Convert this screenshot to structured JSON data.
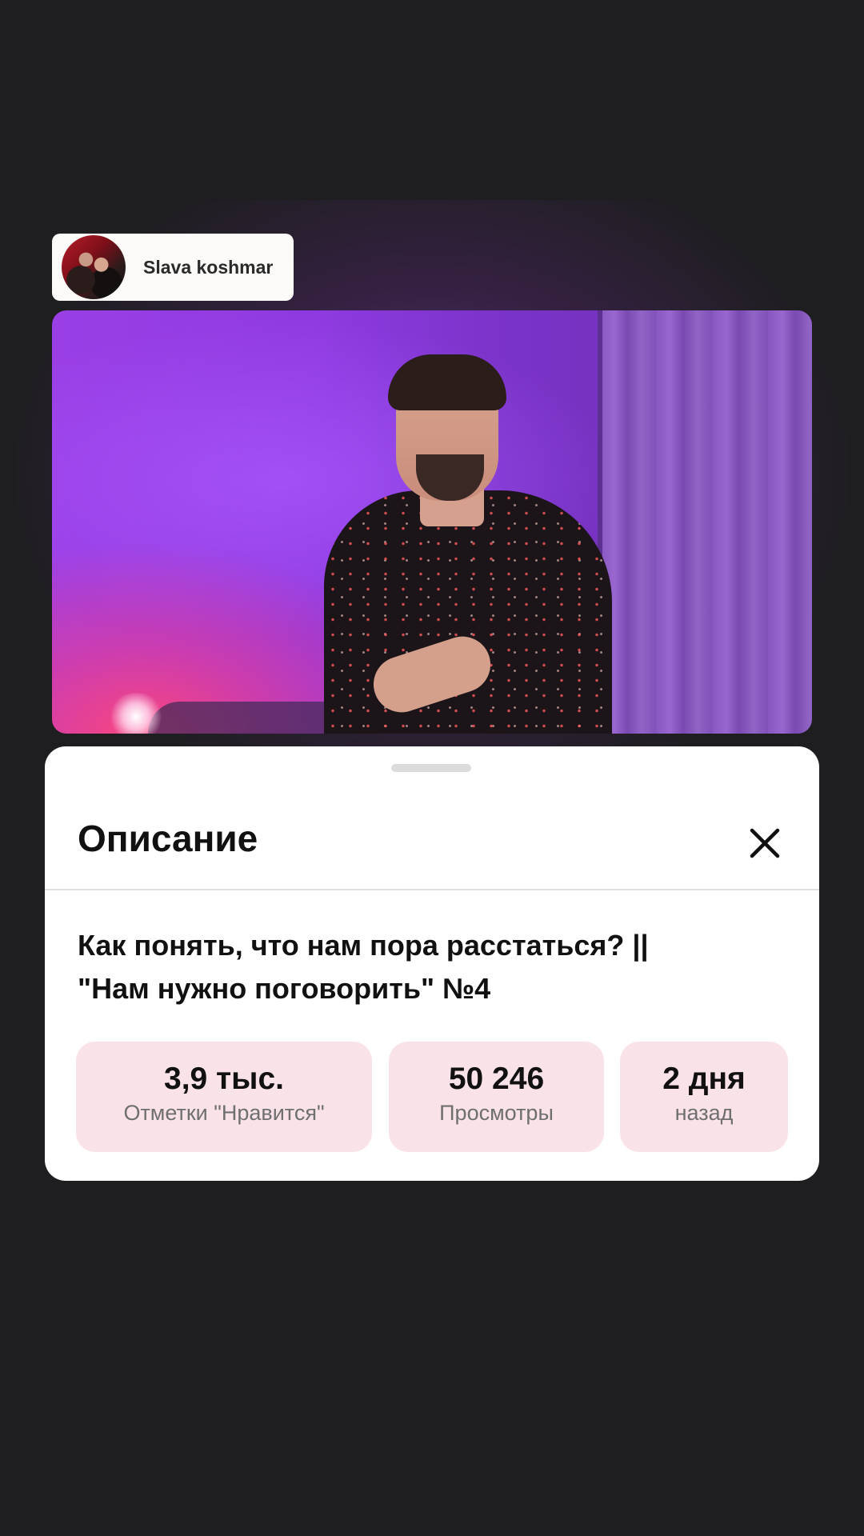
{
  "channel": {
    "name": "Slava koshmar"
  },
  "sheet": {
    "title": "Описание",
    "close_icon": "close-icon"
  },
  "video": {
    "title_line1": "Как понять, что нам пора расстаться? ||",
    "title_line2": "\"Нам нужно поговорить\" №4"
  },
  "stats": {
    "likes": {
      "value": "3,9 тыс.",
      "label": "Отметки \"Нравится\""
    },
    "views": {
      "value": "50 246",
      "label": "Просмотры"
    },
    "date": {
      "value": "2 дня",
      "label": "назад"
    }
  },
  "colors": {
    "background": "#1e1e20",
    "sheet": "#ffffff",
    "stat_card": "#f9e3e8",
    "video_accent": "#9a3fe6"
  }
}
